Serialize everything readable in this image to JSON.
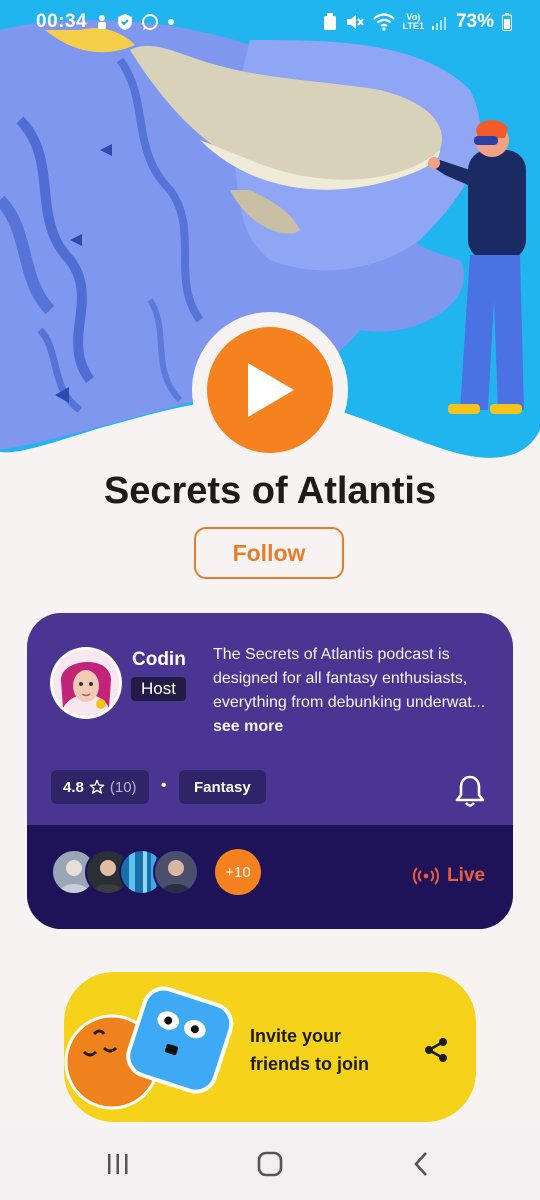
{
  "status_bar": {
    "time": "00:34",
    "network_top": "Vo)",
    "network_bottom": "LTE1",
    "battery": "73%",
    "left_icons": [
      "usb-debug-icon",
      "shield-check-icon",
      "whatsapp-icon",
      "dot-icon"
    ],
    "right_icons": [
      "alarm-icon",
      "mute-icon",
      "wifi-icon",
      "signal-icon",
      "battery-icon"
    ]
  },
  "podcast": {
    "title": "Secrets of Atlantis",
    "follow_label": "Follow"
  },
  "card": {
    "host_name": "Codin",
    "host_badge": "Host",
    "description": "The Secrets of Atlantis podcast is designed for all fantasy enthusiasts, everything from debunking underwat...",
    "see_more": "see more",
    "rating": "4.8",
    "rating_count": "(10)",
    "genre": "Fantasy",
    "listeners_more": "+10",
    "live_label": "Live"
  },
  "invite": {
    "text": "Invite your friends to join"
  },
  "colors": {
    "accent": "#f5821f",
    "card": "#4a3593",
    "card_dark": "#1e1358",
    "invite": "#f7d21a",
    "live": "#ef5a3d"
  }
}
